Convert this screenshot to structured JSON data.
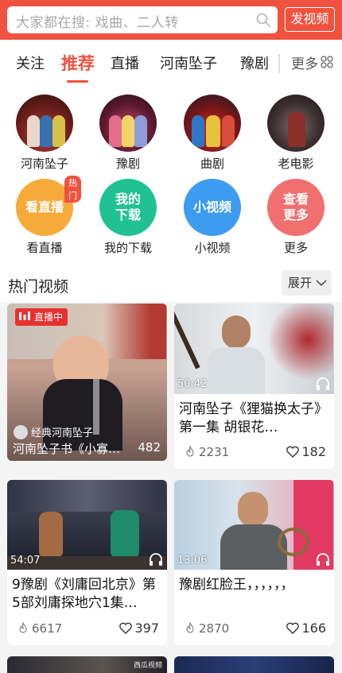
{
  "search": {
    "placeholder": "大家都在搜: 戏曲、二人转",
    "post_label": "发视频"
  },
  "tabs": {
    "items": [
      {
        "label": "关注"
      },
      {
        "label": "推荐",
        "active": true
      },
      {
        "label": "直播"
      },
      {
        "label": "河南坠子"
      },
      {
        "label": "豫剧"
      }
    ],
    "more_label": "更多"
  },
  "categories": [
    {
      "label": "河南坠子"
    },
    {
      "label": "豫剧"
    },
    {
      "label": "曲剧"
    },
    {
      "label": "老电影"
    }
  ],
  "shortcuts": [
    {
      "icon_text": "看直播",
      "label": "看直播",
      "badge": "热门",
      "color": "#f6aa3a"
    },
    {
      "icon_text_1": "我的",
      "icon_text_2": "下载",
      "label": "我的下载",
      "color": "#20c293"
    },
    {
      "icon_text": "小视频",
      "label": "小视频",
      "color": "#3d9cf0"
    },
    {
      "icon_text_1": "查看",
      "icon_text_2": "更多",
      "label": "更多",
      "color": "#f26f70"
    }
  ],
  "hot": {
    "title": "热门视频",
    "expand_label": "展开"
  },
  "videos": [
    {
      "live": true,
      "live_label": "直播中",
      "channel": "经典河南坠子",
      "title": "河南坠子书《小寡…",
      "viewers": "482"
    },
    {
      "duration": "50:42",
      "title": "河南坠子《狸猫换太子》第一集 胡银花…",
      "plays": "2231",
      "likes": "182"
    },
    {
      "duration": "54:07",
      "title": "9豫剧《刘庸回北京》第5部刘庸探地穴1集…",
      "plays": "6617",
      "likes": "397"
    },
    {
      "duration": "13:06",
      "title": "豫剧红脸王，，，，，，",
      "plays": "2870",
      "likes": "166"
    }
  ],
  "bottom_peek": {
    "watermark": "西瓜视频"
  },
  "colors": {
    "accent": "#f0523f"
  }
}
